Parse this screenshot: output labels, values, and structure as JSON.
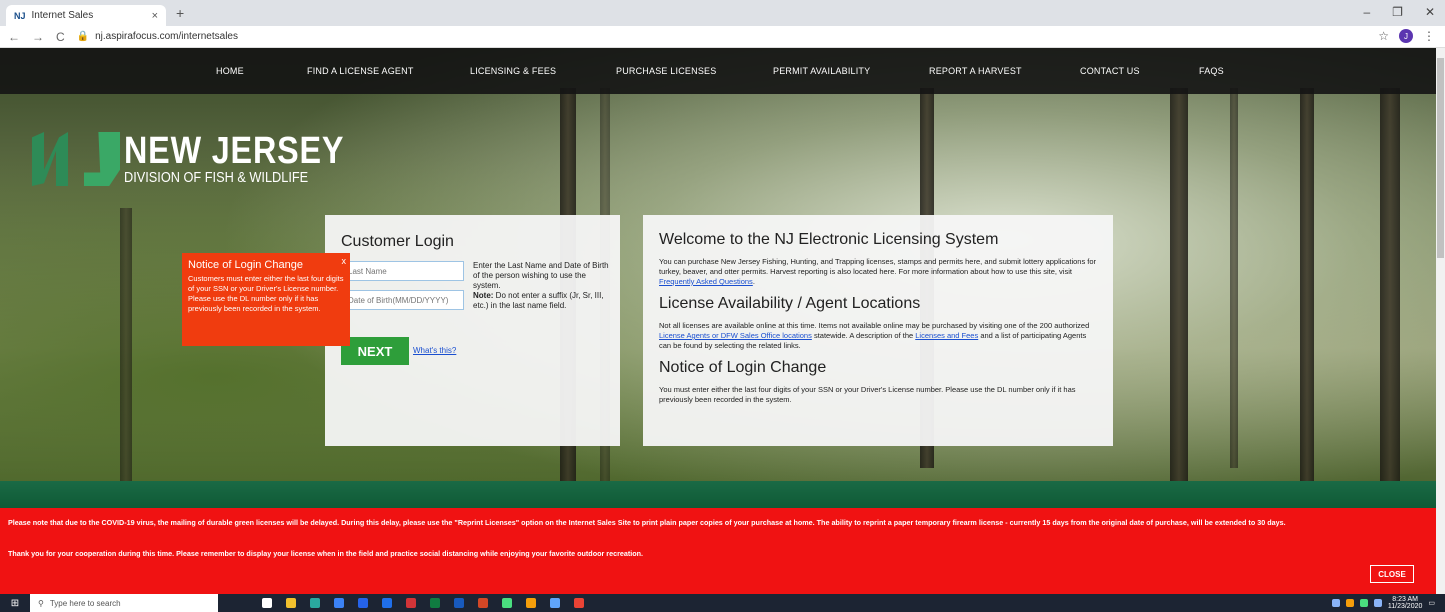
{
  "browser": {
    "tab_favicon": "NJ",
    "tab_title": "Internet Sales",
    "tab_close": "×",
    "new_tab": "+",
    "url": "nj.aspirafocus.com/internetsales",
    "profile_initial": "J",
    "window_controls": [
      "–",
      "❐",
      "✕"
    ]
  },
  "nav": {
    "items": [
      "HOME",
      "FIND A LICENSE AGENT",
      "LICENSING & FEES",
      "PURCHASE LICENSES",
      "PERMIT AVAILABILITY",
      "REPORT A HARVEST",
      "CONTACT US",
      "FAQS"
    ]
  },
  "logo": {
    "line1": "NEW JERSEY",
    "line2": "DIVISION OF FISH & WILDLIFE"
  },
  "login": {
    "title": "Customer Login",
    "last_name_placeholder": "Last Name",
    "dob_placeholder": "Date of Birth(MM/DD/YYYY)",
    "help_text": "Enter the Last Name and Date of Birth of the person wishing to use the system.",
    "note_label": "Note:",
    "note_text": " Do not enter a suffix (Jr, Sr, III, etc.) in the last name field.",
    "next_label": "NEXT",
    "whats_this": "What's this?"
  },
  "popup": {
    "title": "Notice of Login Change",
    "close": "x",
    "body": "Customers must enter either the last four digits of your SSN or your Driver's License number. Please use the DL number only if it has previously been recorded in the system."
  },
  "welcome": {
    "title": "Welcome to the NJ Electronic Licensing System",
    "p1": "You can purchase New Jersey Fishing, Hunting, and Trapping licenses, stamps and permits here, and submit lottery applications for turkey, beaver, and otter permits. Harvest reporting is also located here. For more information about how to use this site, visit ",
    "p1_link": "Frequently Asked Questions",
    "p1_end": ".",
    "h2": "License Availability / Agent Locations",
    "p2a": "Not all licenses are available online at this time. Items not available online may be purchased by visiting one of the 200 authorized ",
    "p2_link1": "License Agents or DFW Sales Office locations",
    "p2b": " statewide. A description of the ",
    "p2_link2": "Licenses and Fees",
    "p2c": " and a list of participating Agents can be found by selecting the related links.",
    "h3": "Notice of Login Change",
    "p3": "You must enter either the last four digits of your SSN or your Driver's License number. Please use the DL number only if it has previously been recorded in the system."
  },
  "banner": {
    "line1": "Please note that due to the COVID-19 virus, the mailing of durable green licenses will be delayed. During this delay, please use the \"Reprint Licenses\" option on the Internet Sales Site to print plain paper copies of your purchase at home. The ability to reprint a paper temporary firearm license - currently 15 days from the original date of purchase, will be extended to 30 days.",
    "line2": "Thank you for your cooperation during this time. Please remember to display your license when in the field and practice social distancing while enjoying your favorite outdoor recreation.",
    "close_label": "CLOSE"
  },
  "taskbar": {
    "search_placeholder": "Type here to search",
    "time": "8:23 AM",
    "date": "11/23/2020",
    "app_colors": [
      "#ffffff",
      "#f2c12e",
      "#2aa9a0",
      "#3b82f6",
      "#2563eb",
      "#1f6feb",
      "#d13438",
      "#107c41",
      "#185abd",
      "#d24726",
      "#4ade80",
      "#f59e0b",
      "#60a5fa",
      "#ea4335"
    ]
  }
}
